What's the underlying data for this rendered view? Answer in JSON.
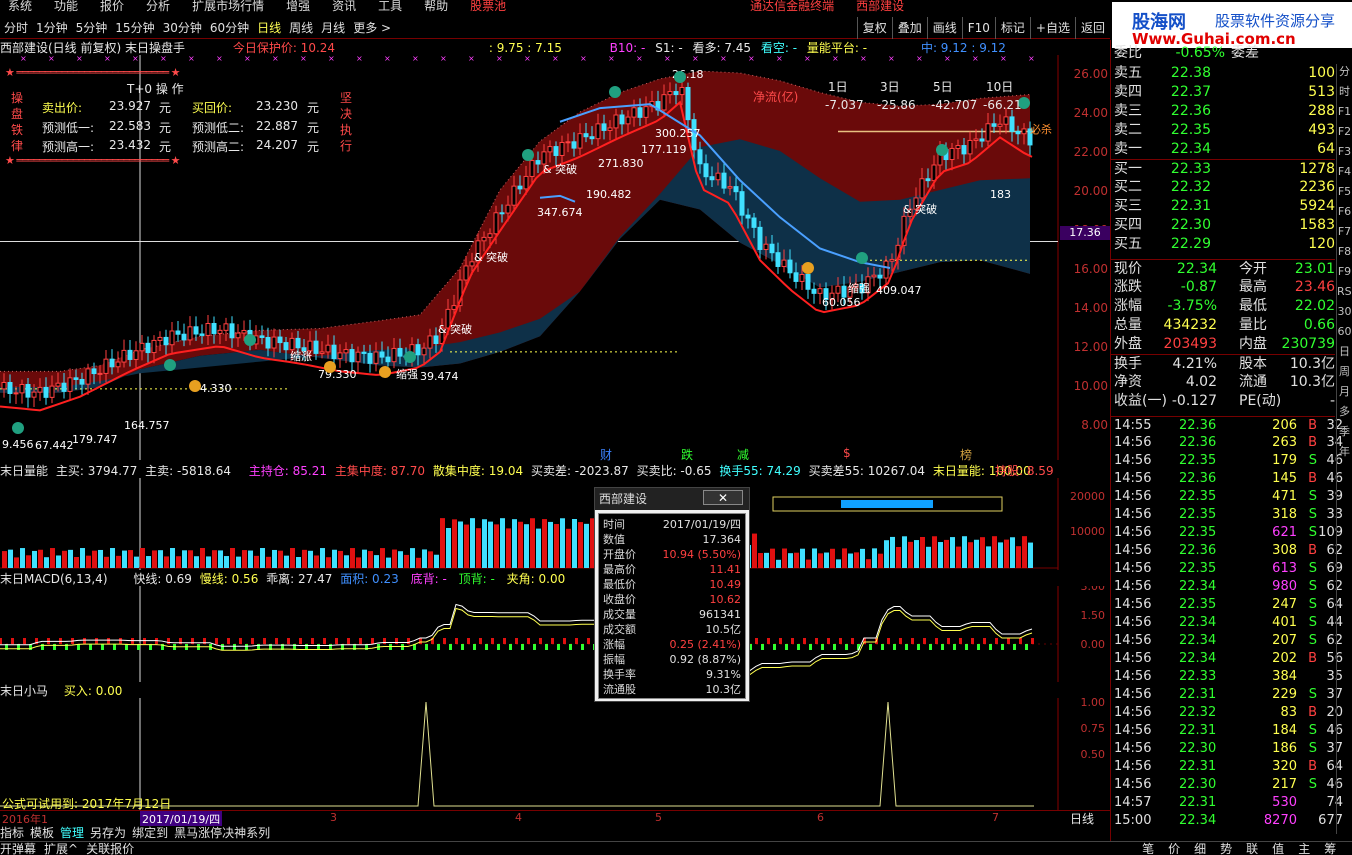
{
  "menu": [
    "系统",
    "功能",
    "报价",
    "分析",
    "扩展市场行情",
    "增强",
    "资讯",
    "工具",
    "帮助"
  ],
  "menu_alert": "股票池",
  "menu_right": [
    "通达信金融终端",
    "西部建设"
  ],
  "periods": [
    "分时",
    "1分钟",
    "5分钟",
    "15分钟",
    "30分钟",
    "60分钟",
    "日线",
    "周线",
    "月线",
    "更多 >"
  ],
  "active_period": "日线",
  "tool_buttons": [
    "复权",
    "叠加",
    "画线",
    "F10",
    "标记",
    "+自选",
    "返回"
  ],
  "logo": {
    "line1": "股海网",
    "line2": "股票软件资源分享",
    "line3": "Www.Guhai.com.cn"
  },
  "main_header": {
    "title": "西部建设(日线 前复权) 末日操盘手",
    "protect": "今日保护价: 10.24",
    "range": ": 9.75 : 7.15",
    "b10": "B10: -",
    "s1": "S1: -",
    "kanduo": "看多: 7.45",
    "kankong": "看空: -",
    "liangneng": "量能平台: -",
    "zhong": "中: 9.12 : 9.12"
  },
  "t0": {
    "title": "T+0 操 作",
    "side": "操盘铁律",
    "side2": "坚决执行",
    "sell_label": "卖出价:",
    "sell_val": "23.927",
    "unit": "元",
    "buy_label": "买回价:",
    "buy_val": "23.230",
    "low1_label": "预测低一:",
    "low1_val": "22.583",
    "low2_label": "预测低二:",
    "low2_val": "22.887",
    "high1_label": "预测高一:",
    "high1_val": "23.432",
    "high2_label": "预测高二:",
    "high2_val": "24.207"
  },
  "netflow": {
    "label": "净流(亿)",
    "periods": [
      "1日",
      "3日",
      "5日",
      "10日"
    ],
    "values": [
      "-7.037",
      "-25.86",
      "-42.707",
      "-66.21"
    ]
  },
  "price_axis": [
    "26.00",
    "24.00",
    "22.00",
    "20.00",
    "18.00",
    "16.00",
    "14.00",
    "12.00",
    "10.00",
    "8.00"
  ],
  "cursor_price": "17.36",
  "chart_labels": [
    {
      "text": "26.18"
    },
    {
      "text": "300.257"
    },
    {
      "text": "271.830"
    },
    {
      "text": "177.119"
    },
    {
      "text": "190.482"
    },
    {
      "text": "347.674"
    },
    {
      "text": "& 突破"
    },
    {
      "text": "& 突破"
    },
    {
      "text": "& 突破"
    },
    {
      "text": "& 突破"
    },
    {
      "text": "60.056"
    },
    {
      "text": "409.047"
    },
    {
      "text": "缩强"
    },
    {
      "text": "183"
    },
    {
      "text": "必杀"
    },
    {
      "text": "9.456"
    },
    {
      "text": "67.442"
    },
    {
      "text": "179.747"
    },
    {
      "text": "164.757"
    },
    {
      "text": "4.330"
    },
    {
      "text": "79.330"
    },
    {
      "text": "缩涨"
    },
    {
      "text": "39.474"
    },
    {
      "text": "缩强"
    }
  ],
  "markers_row": [
    "财",
    "跌",
    "减",
    "$",
    "榜"
  ],
  "vol_header": {
    "name": "末日量能",
    "zhumai": "主买: 3794.77",
    "zhumai2": "主卖: -5818.64",
    "zhuchi": "主持仓: 85.21",
    "zhuji": "主集中度: 87.70",
    "sanji": "散集中度: 19.04",
    "maimai": "买卖差: -2023.87",
    "maimaibi": "买卖比: -0.65",
    "huanshou": "换手55: 74.29",
    "maimai55": "买卖差55: 10267.04",
    "liangneng": "末日量能: 100.00",
    "chigu": "持股: 8.59"
  },
  "vol_axis": [
    "20000",
    "10000"
  ],
  "macd_header": {
    "name": "末日MACD(6,13,4)",
    "kuai": "快线: 0.69",
    "man": "慢线: 0.56",
    "guai": "乖离: 27.47",
    "mianji": "面积: 0.23",
    "dibei": "底背: -",
    "dingbei": "顶背: -",
    "jiajiao": "夹角: 0.00"
  },
  "macd_axis": [
    "3.00",
    "1.50",
    "0.00"
  ],
  "horse_header": {
    "name": "末日小马",
    "buy": "买入: 0.00"
  },
  "horse_axis": [
    "1.00",
    "0.75",
    "0.50"
  ],
  "formula_expire": "公式可试用到: 2017年7月12日",
  "date_axis": [
    "2016年1",
    "2017/01/19/四",
    "3",
    "4",
    "5",
    "6",
    "7"
  ],
  "period_label": "日线",
  "popup": {
    "title": "西部建设",
    "close": "✕",
    "rows": [
      {
        "k": "时间",
        "v": "2017/01/19/四",
        "c": "#e0e0e0"
      },
      {
        "k": "数值",
        "v": "17.364",
        "c": "#e0e0e0"
      },
      {
        "k": "开盘价",
        "v": "10.94 (5.50%)",
        "c": "#ff4040"
      },
      {
        "k": "最高价",
        "v": "11.41",
        "c": "#ff4040"
      },
      {
        "k": "最低价",
        "v": "10.49",
        "c": "#ff4040"
      },
      {
        "k": "收盘价",
        "v": "10.62",
        "c": "#ff4040"
      },
      {
        "k": "成交量",
        "v": "961341",
        "c": "#e0e0e0"
      },
      {
        "k": "成交额",
        "v": "10.5亿",
        "c": "#e0e0e0"
      },
      {
        "k": "涨幅",
        "v": "0.25 (2.41%)",
        "c": "#ff4040"
      },
      {
        "k": "振幅",
        "v": "0.92 (8.87%)",
        "c": "#e0e0e0"
      },
      {
        "k": "换手率",
        "v": "9.31%",
        "c": "#e0e0e0"
      },
      {
        "k": "流通股",
        "v": "10.3亿",
        "c": "#e0e0e0"
      }
    ]
  },
  "orderbook_header": {
    "k": "委比",
    "v": "-0.65%",
    "k2": "委差",
    "v2": "-"
  },
  "orderbook": [
    {
      "k": "卖五",
      "p": "22.38",
      "v": "100"
    },
    {
      "k": "卖四",
      "p": "22.37",
      "v": "513"
    },
    {
      "k": "卖三",
      "p": "22.36",
      "v": "288"
    },
    {
      "k": "卖二",
      "p": "22.35",
      "v": "493"
    },
    {
      "k": "卖一",
      "p": "22.34",
      "v": "64"
    },
    {
      "k": "买一",
      "p": "22.33",
      "v": "1278"
    },
    {
      "k": "买二",
      "p": "22.32",
      "v": "2236"
    },
    {
      "k": "买三",
      "p": "22.31",
      "v": "5924"
    },
    {
      "k": "买四",
      "p": "22.30",
      "v": "1583"
    },
    {
      "k": "买五",
      "p": "22.29",
      "v": "120"
    }
  ],
  "stats": [
    {
      "k": "现价",
      "v": "22.34",
      "c": "#30ff30",
      "k2": "今开",
      "v2": "23.01",
      "c2": "#30ff30"
    },
    {
      "k": "涨跌",
      "v": "-0.87",
      "c": "#30ff30",
      "k2": "最高",
      "v2": "23.46",
      "c2": "#ff4040"
    },
    {
      "k": "涨幅",
      "v": "-3.75%",
      "c": "#30ff30",
      "k2": "最低",
      "v2": "22.02",
      "c2": "#30ff30"
    },
    {
      "k": "总量",
      "v": "434232",
      "c": "#ffff50",
      "k2": "量比",
      "v2": "0.66",
      "c2": "#30ff30"
    },
    {
      "k": "外盘",
      "v": "203493",
      "c": "#ff4040",
      "k2": "内盘",
      "v2": "230739",
      "c2": "#30ff30"
    },
    {
      "k": "换手",
      "v": "4.21%",
      "c": "#e0e0e0",
      "k2": "股本",
      "v2": "10.3亿",
      "c2": "#e0e0e0"
    },
    {
      "k": "净资",
      "v": "4.02",
      "c": "#e0e0e0",
      "k2": "流通",
      "v2": "10.3亿",
      "c2": "#e0e0e0"
    },
    {
      "k": "收益(一)",
      "v": "-0.127",
      "c": "#e0e0e0",
      "k2": "PE(动)",
      "v2": "-",
      "c2": "#e0e0e0"
    }
  ],
  "ticks": [
    {
      "t": "14:55",
      "p": "22.36",
      "v": "206",
      "bs": "B",
      "n": "32"
    },
    {
      "t": "14:56",
      "p": "22.36",
      "v": "263",
      "bs": "B",
      "n": "34"
    },
    {
      "t": "14:56",
      "p": "22.35",
      "v": "179",
      "bs": "S",
      "n": "46"
    },
    {
      "t": "14:56",
      "p": "22.36",
      "v": "145",
      "bs": "B",
      "n": "46"
    },
    {
      "t": "14:56",
      "p": "22.35",
      "v": "471",
      "bs": "S",
      "n": "39"
    },
    {
      "t": "14:56",
      "p": "22.35",
      "v": "318",
      "bs": "S",
      "n": "33"
    },
    {
      "t": "14:56",
      "p": "22.35",
      "v": "621",
      "bs": "S",
      "n": "109"
    },
    {
      "t": "14:56",
      "p": "22.36",
      "v": "308",
      "bs": "B",
      "n": "62"
    },
    {
      "t": "14:56",
      "p": "22.35",
      "v": "613",
      "bs": "S",
      "n": "69"
    },
    {
      "t": "14:56",
      "p": "22.34",
      "v": "980",
      "bs": "S",
      "n": "62"
    },
    {
      "t": "14:56",
      "p": "22.35",
      "v": "247",
      "bs": "S",
      "n": "64"
    },
    {
      "t": "14:56",
      "p": "22.34",
      "v": "401",
      "bs": "S",
      "n": "44"
    },
    {
      "t": "14:56",
      "p": "22.34",
      "v": "207",
      "bs": "S",
      "n": "62"
    },
    {
      "t": "14:56",
      "p": "22.34",
      "v": "202",
      "bs": "B",
      "n": "56"
    },
    {
      "t": "14:56",
      "p": "22.33",
      "v": "384",
      "bs": "",
      "n": "35"
    },
    {
      "t": "14:56",
      "p": "22.31",
      "v": "229",
      "bs": "S",
      "n": "37"
    },
    {
      "t": "14:56",
      "p": "22.32",
      "v": "83",
      "bs": "B",
      "n": "20"
    },
    {
      "t": "14:56",
      "p": "22.31",
      "v": "184",
      "bs": "S",
      "n": "46"
    },
    {
      "t": "14:56",
      "p": "22.30",
      "v": "186",
      "bs": "S",
      "n": "37"
    },
    {
      "t": "14:56",
      "p": "22.31",
      "v": "320",
      "bs": "B",
      "n": "64"
    },
    {
      "t": "14:56",
      "p": "22.30",
      "v": "217",
      "bs": "S",
      "n": "46"
    },
    {
      "t": "14:57",
      "p": "22.31",
      "v": "530",
      "bs": "",
      "n": "74"
    },
    {
      "t": "15:00",
      "p": "22.34",
      "v": "8270",
      "bs": "",
      "n": "677"
    }
  ],
  "sidenav": [
    "分",
    "时",
    "F1",
    "F2",
    "F3",
    "F4",
    "F5",
    "F6",
    "F7",
    "F8",
    "F9",
    "RSI",
    "30",
    "60",
    "日",
    "周",
    "月",
    "多",
    "季",
    "年"
  ],
  "bottom_tabs": [
    "指标",
    "模板",
    "管理",
    "另存为",
    "绑定到",
    "黑马涨停决神系列"
  ],
  "bottom_status": [
    "开弹幕",
    "扩展^",
    "关联报价"
  ],
  "bottom_right_tabs": [
    "笔",
    "价",
    "细",
    "势",
    "联",
    "值",
    "主",
    "筹"
  ],
  "colors": {
    "up": "#ff4040",
    "down": "#30ff30",
    "grid": "#660000",
    "bg": "#000000",
    "band_dark": "#6a0a0a",
    "band_blue": "#0e3048"
  }
}
